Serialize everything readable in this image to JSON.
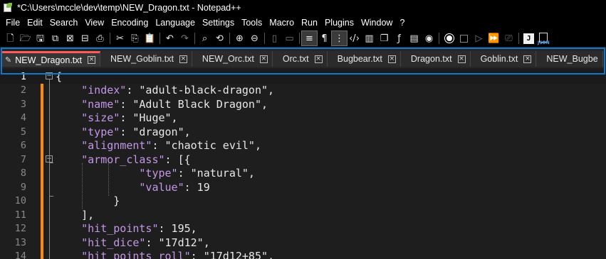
{
  "window": {
    "title": "*C:\\Users\\mccle\\dev\\temp\\NEW_Dragon.txt - Notepad++"
  },
  "menu": [
    "File",
    "Edit",
    "Search",
    "View",
    "Encoding",
    "Language",
    "Settings",
    "Tools",
    "Macro",
    "Run",
    "Plugins",
    "Window",
    "?"
  ],
  "toolbar": {
    "icons": [
      "new-file-icon",
      "open-file-icon",
      "save-icon",
      "save-all-icon",
      "close-icon",
      "close-all-icon",
      "print-icon",
      "cut-icon",
      "copy-icon",
      "paste-icon",
      "undo-icon",
      "redo-icon",
      "find-icon",
      "replace-icon",
      "zoom-in-icon",
      "zoom-out-icon",
      "sync-vertical-icon",
      "sync-horizontal-icon",
      "word-wrap-icon",
      "show-all-chars-icon",
      "indent-guide-icon",
      "xml-tag-icon",
      "document-map-icon",
      "document-list-icon",
      "function-list-icon",
      "folder-workspace-icon",
      "monitor-icon",
      "record-macro-icon",
      "stop-macro-icon",
      "play-macro-icon",
      "run-macro-multiple-icon",
      "save-macro-icon",
      "j-plugin-icon",
      "json-viewer-icon"
    ],
    "json_label": "JSON",
    "j_label": "J"
  },
  "tabs": [
    {
      "label": "NEW_Dragon.txt",
      "active": true,
      "modified": true
    },
    {
      "label": "NEW_Goblin.txt",
      "active": false
    },
    {
      "label": "NEW_Orc.txt",
      "active": false
    },
    {
      "label": "Orc.txt",
      "active": false
    },
    {
      "label": "Bugbear.txt",
      "active": false
    },
    {
      "label": "Dragon.txt",
      "active": false
    },
    {
      "label": "Goblin.txt",
      "active": false
    },
    {
      "label": "NEW_Bugbe",
      "active": false
    }
  ],
  "colors": {
    "accent_tab": "#ff5a5a",
    "change_bar": "#ff8a00",
    "tabbar_highlight": "#1177cc",
    "json_key": "#c497e8"
  },
  "editor": {
    "lines": [
      {
        "n": "1",
        "text": "{"
      },
      {
        "n": "2",
        "key": "\"index\"",
        "rest": ": \"adult-black-dragon\","
      },
      {
        "n": "3",
        "key": "\"name\"",
        "rest": ": \"Adult Black Dragon\","
      },
      {
        "n": "4",
        "key": "\"size\"",
        "rest": ": \"Huge\","
      },
      {
        "n": "5",
        "key": "\"type\"",
        "rest": ": \"dragon\","
      },
      {
        "n": "6",
        "key": "\"alignment\"",
        "rest": ": \"chaotic evil\","
      },
      {
        "n": "7",
        "key": "\"armor_class\"",
        "rest": ": [{"
      },
      {
        "n": "8",
        "key": "\"type\"",
        "rest": ": \"natural\","
      },
      {
        "n": "9",
        "key": "\"value\"",
        "rest": ": 19"
      },
      {
        "n": "10",
        "text": "}"
      },
      {
        "n": "11",
        "text": "],"
      },
      {
        "n": "12",
        "key": "\"hit_points\"",
        "rest": ": 195,"
      },
      {
        "n": "13",
        "key": "\"hit_dice\"",
        "rest": ": \"17d12\","
      },
      {
        "n": "14",
        "key": "\"hit_points_roll\"",
        "rest": ": \"17d12+85\","
      }
    ]
  }
}
